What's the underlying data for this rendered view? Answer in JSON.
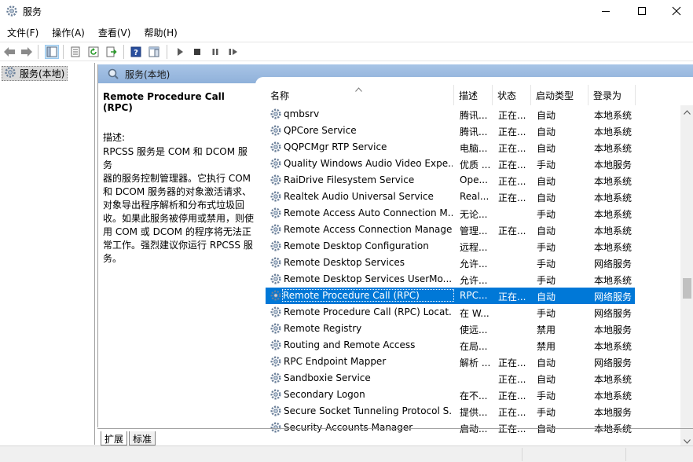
{
  "window": {
    "title": "服务"
  },
  "menu": [
    "文件(F)",
    "操作(A)",
    "查看(V)",
    "帮助(H)"
  ],
  "tree": {
    "item": "服务(本地)"
  },
  "panel": {
    "header": "服务(本地)",
    "service_title": "Remote Procedure Call (RPC)",
    "desc_label": "描述:",
    "desc_lines": [
      "RPCSS 服务是 COM 和 DCOM 服务",
      "器的服务控制管理器。它执行 COM",
      "和 DCOM 服务器的对象激活请求、",
      "对象导出程序解析和分布式垃圾回",
      "收。如果此服务被停用或禁用，则使",
      "用 COM 或 DCOM 的程序将无法正",
      "常工作。强烈建议你运行 RPCSS 服",
      "务。"
    ]
  },
  "columns": {
    "name": "名称",
    "desc": "描述",
    "status": "状态",
    "startup": "启动类型",
    "logon": "登录为"
  },
  "services": [
    {
      "name": "qmbsrv",
      "desc": "腾讯...",
      "status": "正在...",
      "startup": "自动",
      "logon": "本地系统"
    },
    {
      "name": "QPCore Service",
      "desc": "腾讯...",
      "status": "正在...",
      "startup": "自动",
      "logon": "本地系统"
    },
    {
      "name": "QQPCMgr RTP Service",
      "desc": "电脑...",
      "status": "正在...",
      "startup": "自动",
      "logon": "本地系统"
    },
    {
      "name": "Quality Windows Audio Video Expe...",
      "desc": "优质 ...",
      "status": "正在...",
      "startup": "手动",
      "logon": "本地服务"
    },
    {
      "name": "RaiDrive Filesystem Service",
      "desc": "Ope...",
      "status": "正在...",
      "startup": "自动",
      "logon": "本地系统"
    },
    {
      "name": "Realtek Audio Universal Service",
      "desc": "Real...",
      "status": "正在...",
      "startup": "自动",
      "logon": "本地系统"
    },
    {
      "name": "Remote Access Auto Connection M...",
      "desc": "无论...",
      "status": "",
      "startup": "手动",
      "logon": "本地系统"
    },
    {
      "name": "Remote Access Connection Manager",
      "desc": "管理...",
      "status": "正在...",
      "startup": "自动",
      "logon": "本地系统"
    },
    {
      "name": "Remote Desktop Configuration",
      "desc": "远程...",
      "status": "",
      "startup": "手动",
      "logon": "本地系统"
    },
    {
      "name": "Remote Desktop Services",
      "desc": "允许...",
      "status": "",
      "startup": "手动",
      "logon": "网络服务"
    },
    {
      "name": "Remote Desktop Services UserMo...",
      "desc": "允许...",
      "status": "",
      "startup": "手动",
      "logon": "本地系统"
    },
    {
      "name": "Remote Procedure Call (RPC)",
      "desc": "RPC...",
      "status": "正在...",
      "startup": "自动",
      "logon": "网络服务",
      "selected": true
    },
    {
      "name": "Remote Procedure Call (RPC) Locat...",
      "desc": "在 W...",
      "status": "",
      "startup": "手动",
      "logon": "网络服务"
    },
    {
      "name": "Remote Registry",
      "desc": "使远...",
      "status": "",
      "startup": "禁用",
      "logon": "本地服务"
    },
    {
      "name": "Routing and Remote Access",
      "desc": "在局...",
      "status": "",
      "startup": "禁用",
      "logon": "本地系统"
    },
    {
      "name": "RPC Endpoint Mapper",
      "desc": "解析 ...",
      "status": "正在...",
      "startup": "自动",
      "logon": "网络服务"
    },
    {
      "name": "Sandboxie Service",
      "desc": "",
      "status": "正在...",
      "startup": "自动",
      "logon": "本地系统"
    },
    {
      "name": "Secondary Logon",
      "desc": "在不...",
      "status": "正在...",
      "startup": "手动",
      "logon": "本地系统"
    },
    {
      "name": "Secure Socket Tunneling Protocol S...",
      "desc": "提供...",
      "status": "正在...",
      "startup": "手动",
      "logon": "本地服务"
    },
    {
      "name": "Security Accounts Manager",
      "desc": "启动...",
      "status": "正在...",
      "startup": "自动",
      "logon": "本地系统"
    }
  ],
  "tabs": [
    "扩展",
    "标准"
  ],
  "colors": {
    "selection": "#0078d7",
    "header_blue": "#9bbbe0"
  }
}
